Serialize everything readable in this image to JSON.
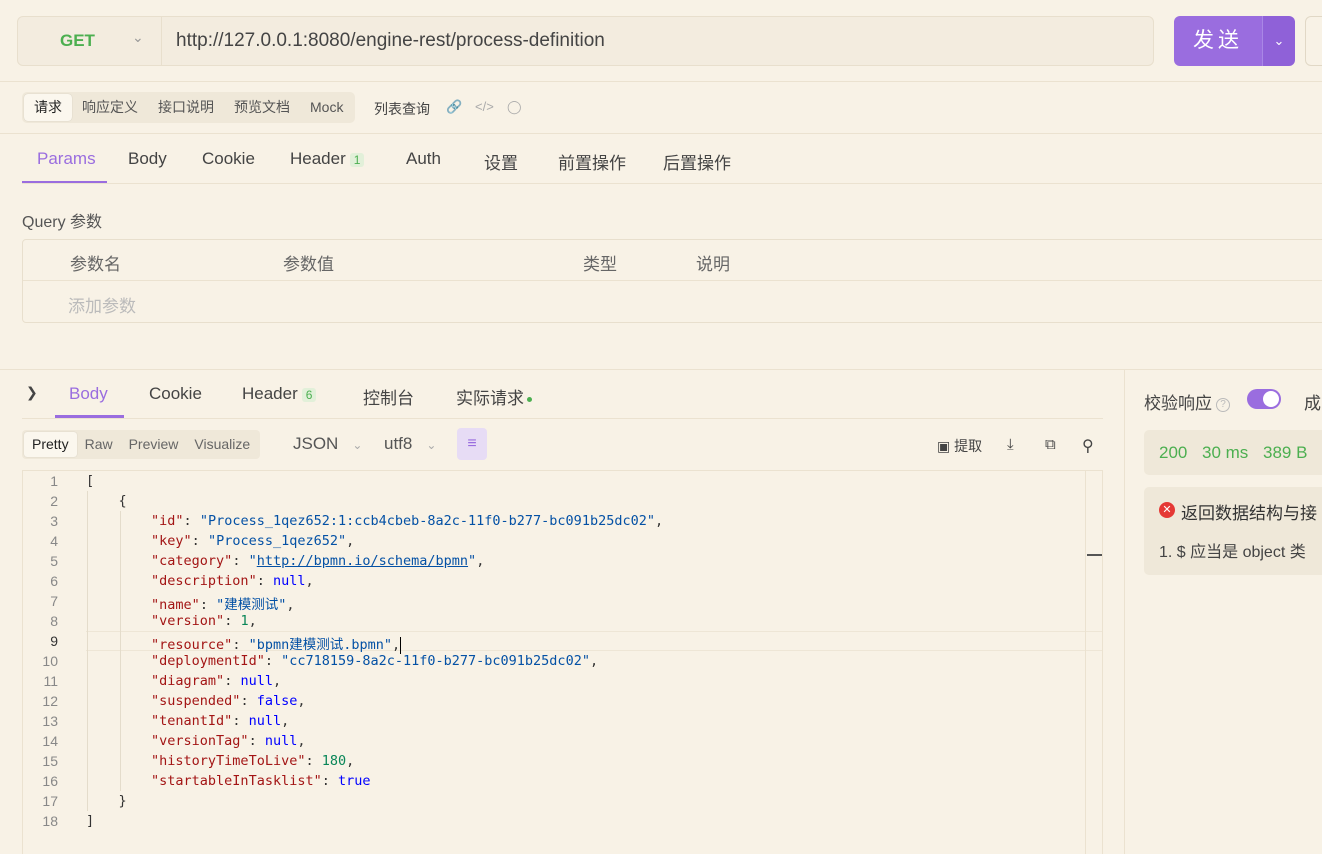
{
  "request": {
    "method": "GET",
    "url": "http://127.0.0.1:8080/engine-rest/process-definition",
    "send_label": "发送"
  },
  "sub_tabs": [
    "请求",
    "响应定义",
    "接口说明",
    "预览文档",
    "Mock"
  ],
  "list_query_label": "列表查询",
  "request_tabs": {
    "params": "Params",
    "body": "Body",
    "cookie": "Cookie",
    "header": "Header",
    "header_count": "1",
    "auth": "Auth",
    "settings": "设置",
    "pre": "前置操作",
    "post": "后置操作"
  },
  "query": {
    "title": "Query 参数",
    "columns": [
      "参数名",
      "参数值",
      "类型",
      "说明"
    ],
    "add_placeholder": "添加参数"
  },
  "response_tabs": {
    "body": "Body",
    "cookie": "Cookie",
    "header": "Header",
    "header_count": "6",
    "console": "控制台",
    "actual": "实际请求"
  },
  "view_tabs": [
    "Pretty",
    "Raw",
    "Preview",
    "Visualize"
  ],
  "format": "JSON",
  "encoding": "utf8",
  "extract_label": "提取",
  "code_lines": [
    "1",
    "2",
    "3",
    "4",
    "5",
    "6",
    "7",
    "8",
    "9",
    "10",
    "11",
    "12",
    "13",
    "14",
    "15",
    "16",
    "17",
    "18"
  ],
  "json": {
    "id": "\"Process_1qez652:1:ccb4cbeb-8a2c-11f0-b277-bc091b25dc02\"",
    "key": "\"Process_1qez652\"",
    "category": "http://bpmn.io/schema/bpmn",
    "description": "null",
    "name": "\"建模测试\"",
    "version": "1",
    "resource": "\"bpmn建模测试.bpmn\"",
    "deploymentId": "\"cc718159-8a2c-11f0-b277-bc091b25dc02\"",
    "diagram": "null",
    "suspended": "false",
    "tenantId": "null",
    "versionTag": "null",
    "historyTimeToLive": "180",
    "startableInTasklist": "true"
  },
  "verify": {
    "label": "校验响应",
    "enabled": true,
    "result_label_partial": "成"
  },
  "status": {
    "code": "200",
    "time": "30 ms",
    "size": "389 B"
  },
  "error": {
    "title": "返回数据结构与接",
    "item": "1. $ 应当是 object 类"
  },
  "colors": {
    "accent": "#9a6ddf",
    "method_get": "#4caf50",
    "error": "#e53935",
    "background": "#f8f2e6"
  }
}
